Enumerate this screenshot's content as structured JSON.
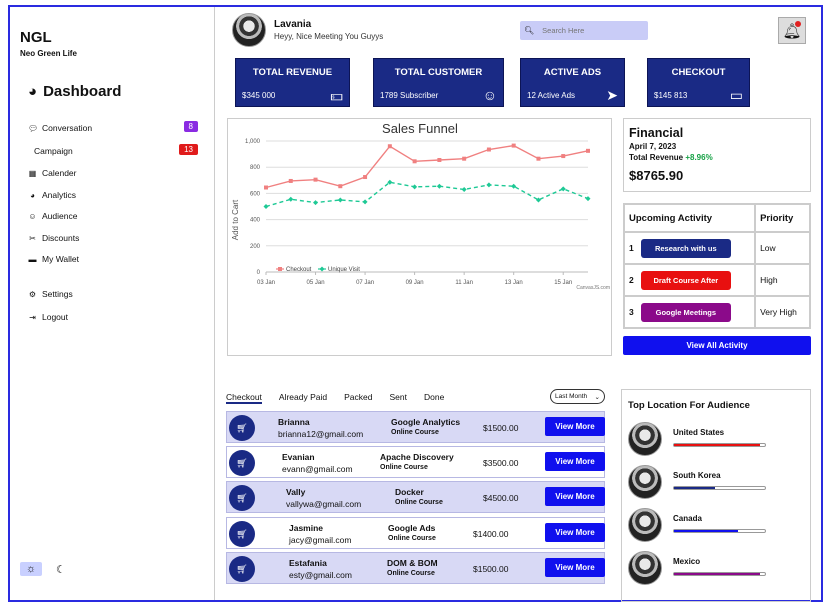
{
  "brand": {
    "name": "NGL",
    "subtitle": "Neo Green Life"
  },
  "dashboard_label": "Dashboard",
  "nav": [
    {
      "label": "Conversation",
      "icon": "chat-icon",
      "badge": "8",
      "badge_color": "#8a2be2"
    },
    {
      "label": "Campaign",
      "icon": "",
      "badge": "13",
      "badge_color": "#e01b1b"
    },
    {
      "label": "Calender",
      "icon": "calendar-icon"
    },
    {
      "label": "Analytics",
      "icon": "gauge-icon"
    },
    {
      "label": "Audience",
      "icon": "smile-icon"
    },
    {
      "label": "Discounts",
      "icon": "scissors-icon"
    },
    {
      "label": "My Wallet",
      "icon": "wallet-icon"
    },
    {
      "label": "Settings",
      "icon": "gear-icon"
    },
    {
      "label": "Logout",
      "icon": "logout-icon"
    }
  ],
  "user": {
    "name": "Lavania",
    "greeting": "Heyy, Nice Meeting You Guyys"
  },
  "search": {
    "placeholder": "Search Here"
  },
  "stats": [
    {
      "label": "TOTAL REVENUE",
      "value": "$345 000",
      "icon": "money-icon"
    },
    {
      "label": "TOTAL CUSTOMER",
      "value": "1789 Subscriber",
      "icon": "smile-icon"
    },
    {
      "label": "ACTIVE ADS",
      "value": "12 Active Ads",
      "icon": "send-icon"
    },
    {
      "label": "CHECKOUT",
      "value": "$145 813",
      "icon": "card-icon"
    }
  ],
  "chart_data": {
    "type": "line",
    "title": "Sales Funnel",
    "ylabel": "Add to Cart",
    "ylim": [
      0,
      1000
    ],
    "yticks": [
      "0",
      "200",
      "400",
      "600",
      "800",
      "1,000"
    ],
    "xticks": [
      "03 Jan",
      "05 Jan",
      "07 Jan",
      "09 Jan",
      "11 Jan",
      "13 Jan",
      "15 Jan"
    ],
    "x": [
      3,
      4,
      5,
      6,
      7,
      8,
      9,
      10,
      11,
      12,
      13,
      14,
      15,
      16
    ],
    "series": [
      {
        "name": "Checkout",
        "color": "#f08080",
        "values": [
          645,
          695,
          705,
          655,
          725,
          960,
          845,
          855,
          865,
          935,
          965,
          865,
          885,
          925
        ]
      },
      {
        "name": "Unique Visit",
        "color": "#1ec995",
        "values": [
          500,
          555,
          530,
          550,
          535,
          685,
          650,
          655,
          630,
          665,
          655,
          550,
          635,
          560
        ]
      }
    ],
    "credit": "CanvasJS.com"
  },
  "financial": {
    "title": "Financial",
    "date": "April 7, 2023",
    "revenue_label": "Total Revenue",
    "revenue_change": "+8.96%",
    "amount": "$8765.90"
  },
  "activity": {
    "headers": [
      "Upcoming Activity",
      "Priority"
    ],
    "rows": [
      {
        "num": "1",
        "label": "Research with us",
        "priority": "Low",
        "color": "#1a2a85"
      },
      {
        "num": "2",
        "label": "Draft Course After",
        "priority": "High",
        "color": "#e81010"
      },
      {
        "num": "3",
        "label": "Google Meetings",
        "priority": "Very High",
        "color": "#8b0a8a"
      }
    ],
    "view_all": "View All Activity"
  },
  "order_tabs": [
    "Checkout",
    "Already Paid",
    "Packed",
    "Sent",
    "Done"
  ],
  "order_filter": "Last Month",
  "orders": [
    {
      "name": "Brianna",
      "email": "brianna12@gmail.com",
      "course": "Google Analytics",
      "sub": "Online Course",
      "amount": "$1500.00",
      "button": "View More"
    },
    {
      "name": "Evanian",
      "email": "evann@gmail.com",
      "course": "Apache Discovery",
      "sub": "Online Course",
      "amount": "$3500.00",
      "button": "View More"
    },
    {
      "name": "Vally",
      "email": "vallywa@gmail.com",
      "course": "Docker",
      "sub": "Online Course",
      "amount": "$4500.00",
      "button": "View More"
    },
    {
      "name": "Jasmine",
      "email": "jacy@gmail.com",
      "course": "Google Ads",
      "sub": "Online Course",
      "amount": "$1400.00",
      "button": "View More"
    },
    {
      "name": "Estafania",
      "email": "esty@gmail.com",
      "course": "DOM & BOM",
      "sub": "Online Course",
      "amount": "$1500.00",
      "button": "View More"
    }
  ],
  "locations": {
    "title": "Top Location For Audience",
    "items": [
      {
        "country": "United States",
        "share": 0.95,
        "color": "#e81010"
      },
      {
        "country": "South Korea",
        "share": 0.45,
        "color": "#1a2a85"
      },
      {
        "country": "Canada",
        "share": 0.7,
        "color": "#1010ee"
      },
      {
        "country": "Mexico",
        "share": 0.95,
        "color": "#8b0a8a"
      }
    ]
  }
}
